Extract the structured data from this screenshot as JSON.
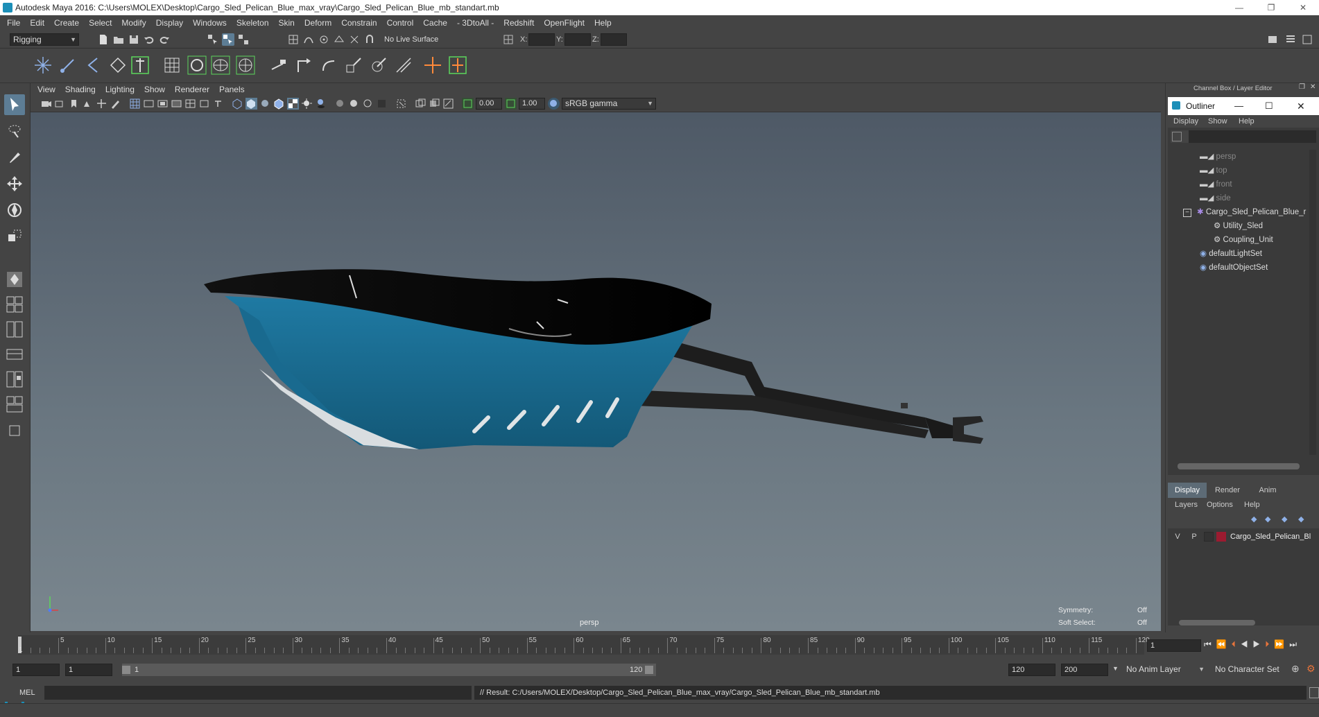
{
  "window": {
    "title": "Autodesk Maya 2016: C:\\Users\\MOLEX\\Desktop\\Cargo_Sled_Pelican_Blue_max_vray\\Cargo_Sled_Pelican_Blue_mb_standart.mb",
    "minimize": "—",
    "restore": "❐",
    "close": "✕"
  },
  "menubar": [
    "File",
    "Edit",
    "Create",
    "Select",
    "Modify",
    "Display",
    "Windows",
    "Skeleton",
    "Skin",
    "Deform",
    "Constrain",
    "Control",
    "Cache",
    "- 3DtoAll -",
    "Redshift",
    "OpenFlight",
    "Help"
  ],
  "statusline": {
    "menu_set": "Rigging",
    "live_surface": "No Live Surface",
    "x_label": "X:",
    "y_label": "Y:",
    "z_label": "Z:"
  },
  "viewport": {
    "menus": [
      "View",
      "Shading",
      "Lighting",
      "Show",
      "Renderer",
      "Panels"
    ],
    "exposure": "0.00",
    "gamma": "1.00",
    "color_space": "sRGB gamma",
    "camera_label": "persp",
    "symmetry_label": "Symmetry:",
    "symmetry_value": "Off",
    "soft_select_label": "Soft Select:",
    "soft_select_value": "Off"
  },
  "right_panel": {
    "header": "Channel Box / Layer Editor",
    "outliner": {
      "title": "Outliner",
      "menus": [
        "Display",
        "Show",
        "Help"
      ],
      "items": [
        {
          "label": "persp",
          "type": "camera"
        },
        {
          "label": "top",
          "type": "camera"
        },
        {
          "label": "front",
          "type": "camera"
        },
        {
          "label": "side",
          "type": "camera"
        },
        {
          "label": "Cargo_Sled_Pelican_Blue_r",
          "type": "group"
        },
        {
          "label": "Utility_Sled",
          "type": "mesh"
        },
        {
          "label": "Coupling_Unit",
          "type": "mesh"
        },
        {
          "label": "defaultLightSet",
          "type": "set"
        },
        {
          "label": "defaultObjectSet",
          "type": "set"
        }
      ]
    },
    "layer_tabs": [
      "Display",
      "Render",
      "Anim"
    ],
    "layer_menus": [
      "Layers",
      "Options",
      "Help"
    ],
    "layer": {
      "v": "V",
      "p": "P",
      "name": "Cargo_Sled_Pelican_Bl",
      "color": "#9b1b30"
    }
  },
  "timeslider": {
    "ticks": [
      "5",
      "10",
      "15",
      "20",
      "25",
      "30",
      "35",
      "40",
      "45",
      "50",
      "55",
      "60",
      "65",
      "70",
      "75",
      "80",
      "85",
      "90",
      "95",
      "100",
      "105",
      "110",
      "115",
      "120"
    ],
    "start_marker": "1",
    "current_frame": "1"
  },
  "range": {
    "start": "1",
    "playback_start": "1",
    "slider_start": "1",
    "slider_end": "120",
    "playback_end": "120",
    "end": "200",
    "anim_layer": "No Anim Layer",
    "character_set": "No Character Set"
  },
  "command": {
    "language": "MEL",
    "result": "// Result: C:/Users/MOLEX/Desktop/Cargo_Sled_Pelican_Blue_max_vray/Cargo_Sled_Pelican_Blue_mb_standart.mb"
  },
  "colors": {
    "accent": "#1c8fb8",
    "sled_blue": "#1b6f95",
    "layer_red": "#9b1b30"
  }
}
